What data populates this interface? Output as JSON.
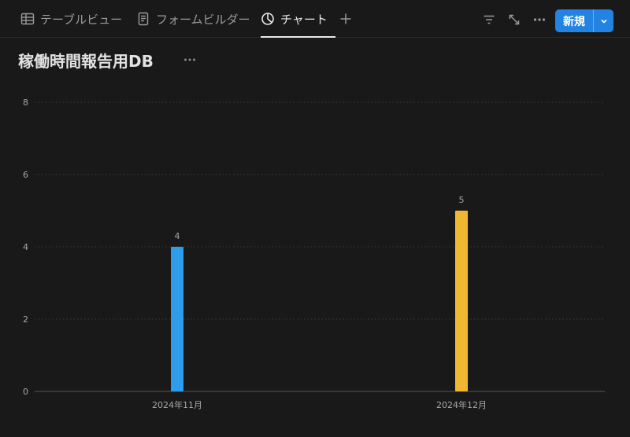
{
  "tabs": [
    {
      "label": "テーブルビュー",
      "icon": "table-icon",
      "active": false
    },
    {
      "label": "フォームビルダー",
      "icon": "form-icon",
      "active": false
    },
    {
      "label": "チャート",
      "icon": "chart-icon",
      "active": true
    }
  ],
  "toolbar": {
    "icons": [
      "filter-icon",
      "expand-icon",
      "more-icon",
      "add-tab-icon"
    ],
    "new_label": "新規"
  },
  "title": "稼働時間報告用DB",
  "colors": {
    "background": "#191919",
    "accent": "#2383e2",
    "bar_blue": "#2d9cea",
    "bar_yellow": "#f0b731"
  },
  "chart_data": {
    "type": "bar",
    "categories": [
      "2024年11月",
      "2024年12月"
    ],
    "values": [
      4,
      5
    ],
    "bar_colors": [
      "#2d9cea",
      "#f0b731"
    ],
    "ylim": [
      0,
      8
    ],
    "yticks": [
      0,
      2,
      4,
      6,
      8
    ],
    "data_labels": [
      "4",
      "5"
    ],
    "grid": true
  }
}
